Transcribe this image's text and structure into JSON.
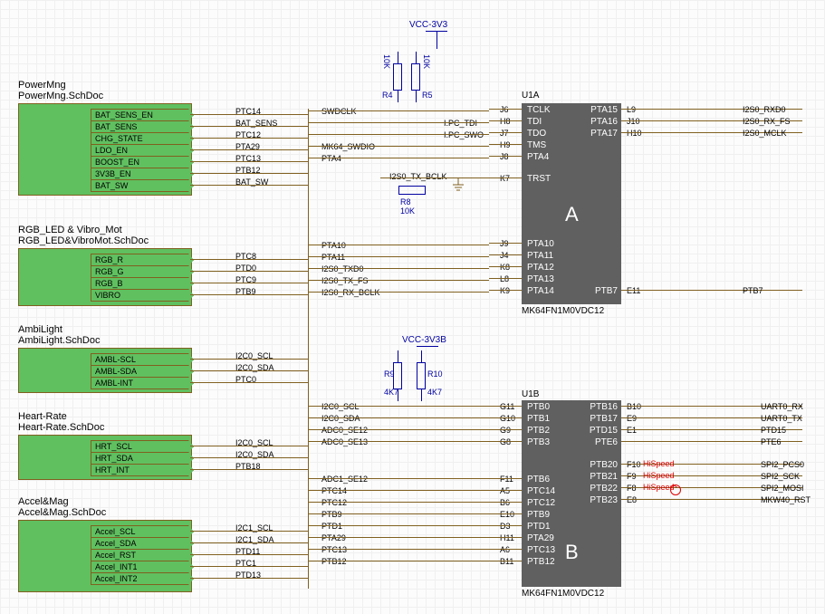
{
  "power_label": "VCC-3V3",
  "power_label2": "VCC-3V3B",
  "blocks": {
    "power": {
      "title": "PowerMng",
      "doc": "PowerMng.SchDoc",
      "ports": [
        "BAT_SENS_EN",
        "BAT_SENS",
        "CHG_STATE",
        "LDO_EN",
        "BOOST_EN",
        "3V3B_EN",
        "BAT_SW"
      ],
      "nets": [
        "PTC14",
        "BAT_SENS",
        "PTC12",
        "PTA29",
        "PTC13",
        "PTB12",
        "BAT_SW"
      ]
    },
    "rgb": {
      "title": "RGB_LED & Vibro_Mot",
      "doc": "RGB_LED&VibroMot.SchDoc",
      "ports": [
        "RGB_R",
        "RGB_G",
        "RGB_B",
        "VIBRO"
      ],
      "nets": [
        "PTC8",
        "PTD0",
        "PTC9",
        "PTB9"
      ]
    },
    "ambi": {
      "title": "AmbiLight",
      "doc": "AmbiLight.SchDoc",
      "ports": [
        "AMBL-SCL",
        "AMBL-SDA",
        "AMBL-INT"
      ],
      "nets": [
        "I2C0_SCL",
        "I2C0_SDA",
        "PTC0"
      ]
    },
    "heart": {
      "title": "Heart-Rate",
      "doc": "Heart-Rate.SchDoc",
      "ports": [
        "HRT_SCL",
        "HRT_SDA",
        "HRT_INT"
      ],
      "nets": [
        "I2C0_SCL",
        "I2C0_SDA",
        "PTB18"
      ]
    },
    "accel": {
      "title": "Accel&Mag",
      "doc": "Accel&Mag.SchDoc",
      "ports": [
        "Accel_SCL",
        "Accel_SDA",
        "Accel_RST",
        "Accel_INT1",
        "Accel_INT2"
      ],
      "nets": [
        "I2C1_SCL",
        "I2C1_SDA",
        "PTD11",
        "PTC1",
        "PTD13"
      ]
    }
  },
  "mid_nets_a": [
    {
      "n": "SWDCLK",
      "pn": ""
    },
    {
      "n": "",
      "pn": "I.PC_TDI"
    },
    {
      "n": "",
      "pn": "I.PC_SWO"
    },
    {
      "n": "MK64_SWDIO",
      "pn": ""
    },
    {
      "n": "PTA4",
      "pn": ""
    }
  ],
  "i2s_nets": [
    "I2S0_TX_BCLK"
  ],
  "mid_nets_a2": [
    "PTA10",
    "PTA11",
    "I2S0_TXD0",
    "I2S0_TX_FS",
    "I2S0_RX_BCLK"
  ],
  "mid_nets_b": [
    "I2C0_SCL",
    "I2C0_SDA",
    "ADC0_SE12",
    "ADC0_SE13"
  ],
  "mid_nets_b2": [
    "ADC1_SE12",
    "PTC14",
    "PTC12",
    "PTB9",
    "PTD1",
    "PTA29",
    "PTC13",
    "PTB12"
  ],
  "chipA": {
    "ref": "U1A",
    "pn": "MK64FN1M0VDC12",
    "letter": "A",
    "pins_l": [
      {
        "num": "J6",
        "name": "TCLK"
      },
      {
        "num": "H8",
        "name": "TDI"
      },
      {
        "num": "J7",
        "name": "TDO"
      },
      {
        "num": "H9",
        "name": "TMS"
      },
      {
        "num": "J8",
        "name": "PTA4"
      },
      {
        "num": "K7",
        "name": "TRST"
      },
      {
        "num": "J9",
        "name": "PTA10"
      },
      {
        "num": "J4",
        "name": "PTA11"
      },
      {
        "num": "K8",
        "name": "PTA12"
      },
      {
        "num": "L8",
        "name": "PTA13"
      },
      {
        "num": "K9",
        "name": "PTA14"
      }
    ],
    "pins_r": [
      {
        "num": "L9",
        "name": "PTA15"
      },
      {
        "num": "J10",
        "name": "PTA16"
      },
      {
        "num": "H10",
        "name": "PTA17"
      },
      {
        "num": "E11",
        "name": "PTB7"
      }
    ],
    "nets_r": [
      "I2S0_RXD0",
      "I2S0_RX_FS",
      "I2S0_MCLK",
      "PTB7"
    ]
  },
  "chipB": {
    "ref": "U1B",
    "pn": "MK64FN1M0VDC12",
    "letter": "B",
    "pins_l": [
      {
        "num": "G11",
        "name": "PTB0"
      },
      {
        "num": "G10",
        "name": "PTB1"
      },
      {
        "num": "G9",
        "name": "PTB2"
      },
      {
        "num": "G8",
        "name": "PTB3"
      },
      {
        "num": "F11",
        "name": "PTB6"
      },
      {
        "num": "A5",
        "name": "PTC14"
      },
      {
        "num": "B6",
        "name": "PTC12"
      },
      {
        "num": "E10",
        "name": "PTB9"
      },
      {
        "num": "D3",
        "name": "PTD1"
      },
      {
        "num": "H11",
        "name": "PTA29"
      },
      {
        "num": "A6",
        "name": "PTC13"
      },
      {
        "num": "B11",
        "name": "PTB12"
      }
    ],
    "pins_r": [
      {
        "num": "B10",
        "name": "PTB16"
      },
      {
        "num": "E9",
        "name": "PTB17"
      },
      {
        "num": "E1",
        "name": "PTD15"
      },
      {
        "num": "",
        "name": "PTE6"
      },
      {
        "num": "F10",
        "name": "PTB20",
        "hs": true
      },
      {
        "num": "F9",
        "name": "PTB21",
        "hs": true
      },
      {
        "num": "F8",
        "name": "PTB22",
        "hs": true
      },
      {
        "num": "E8",
        "name": "PTB23"
      }
    ],
    "nets_r": [
      "UART0_RX",
      "UART0_TX",
      "PTD15",
      "PTE6",
      "SPI2_PCS0",
      "SPI2_SCK",
      "SPI2_MOSI",
      "MKW40_RST"
    ]
  },
  "resistors": {
    "r4": {
      "ref": "R4",
      "val": "10K"
    },
    "r5": {
      "ref": "R5",
      "val": "10K"
    },
    "r8": {
      "ref": "R8",
      "val": "10K"
    },
    "r9": {
      "ref": "R9",
      "val": "4K7"
    },
    "r10": {
      "ref": "R10",
      "val": "4K7"
    }
  },
  "hispeed": "HiSpeed"
}
